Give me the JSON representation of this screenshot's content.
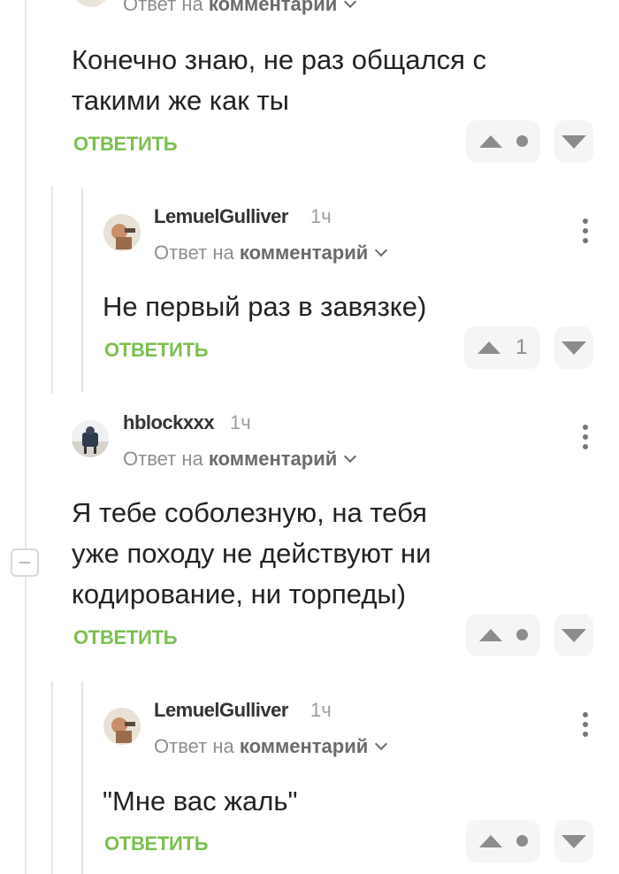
{
  "top_comment": {
    "reply_to_prefix": "Ответ на",
    "reply_to_target": "комментарий",
    "text_line1": "Конечно знаю, не раз общался с",
    "text_line2": "такими же как ты",
    "reply_label": "ОТВЕТИТЬ"
  },
  "reply1": {
    "author": "LemuelGulliver",
    "time": "1ч",
    "reply_to_prefix": "Ответ на",
    "reply_to_target": "комментарий",
    "text": "Не первый раз в завязке)",
    "reply_label": "ОТВЕТИТЬ",
    "rating": "1"
  },
  "comment2": {
    "author": "hblockxxx",
    "time": "1ч",
    "reply_to_prefix": "Ответ на",
    "reply_to_target": "комментарий",
    "text_line1": "Я тебе соболезную, на тебя",
    "text_line2": "уже походу не действуют ни",
    "text_line3": "кодирование, ни торпеды)",
    "reply_label": "ОТВЕТИТЬ"
  },
  "reply2": {
    "author": "LemuelGulliver",
    "time": "1ч",
    "reply_to_prefix": "Ответ на",
    "reply_to_target": "комментарий",
    "text": "\"Мне вас жаль\"",
    "reply_label": "ОТВЕТИТЬ"
  },
  "icons": {
    "upvote": "triangle-up-icon",
    "downvote": "triangle-down-icon",
    "more": "kebab-menu-icon",
    "collapse": "minus-icon"
  },
  "colors": {
    "accent": "#7cbf4f",
    "muted": "#8f8f8f"
  }
}
